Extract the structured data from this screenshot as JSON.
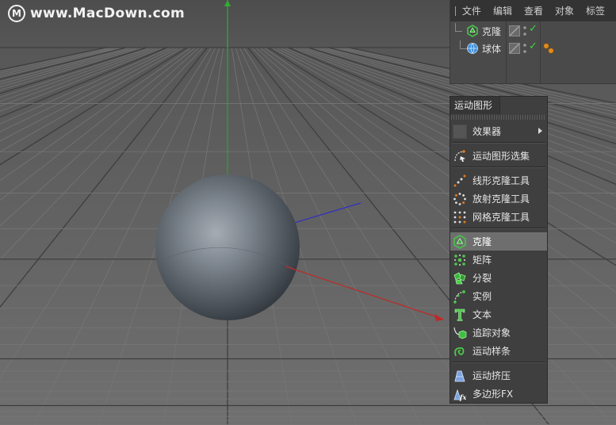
{
  "watermark": {
    "logo_letter": "M",
    "text": "www.MacDown.com"
  },
  "object_manager": {
    "menu": [
      "文件",
      "编辑",
      "查看",
      "对象",
      "标签"
    ],
    "objects": [
      {
        "name": "克隆",
        "icon": "cloner-icon"
      },
      {
        "name": "球体",
        "icon": "sphere-icon"
      }
    ]
  },
  "mograph_menu": {
    "title": "运动图形",
    "items": [
      {
        "label": "效果器",
        "icon": "effector-blank-icon",
        "submenu": true
      },
      {
        "label": "运动图形选集",
        "icon": "mograph-selection-icon"
      },
      {
        "label": "线形克隆工具",
        "icon": "linear-cloner-icon"
      },
      {
        "label": "放射克隆工具",
        "icon": "radial-cloner-icon"
      },
      {
        "label": "网格克隆工具",
        "icon": "grid-cloner-icon"
      },
      {
        "label": "克隆",
        "icon": "cloner-icon",
        "highlighted": true
      },
      {
        "label": "矩阵",
        "icon": "matrix-icon"
      },
      {
        "label": "分裂",
        "icon": "fracture-icon"
      },
      {
        "label": "实例",
        "icon": "instance-icon"
      },
      {
        "label": "文本",
        "icon": "text-icon"
      },
      {
        "label": "追踪对象",
        "icon": "tracer-icon"
      },
      {
        "label": "运动样条",
        "icon": "mospline-icon"
      },
      {
        "label": "运动挤压",
        "icon": "moextrude-icon"
      },
      {
        "label": "多边形FX",
        "icon": "polyfx-icon"
      }
    ]
  }
}
